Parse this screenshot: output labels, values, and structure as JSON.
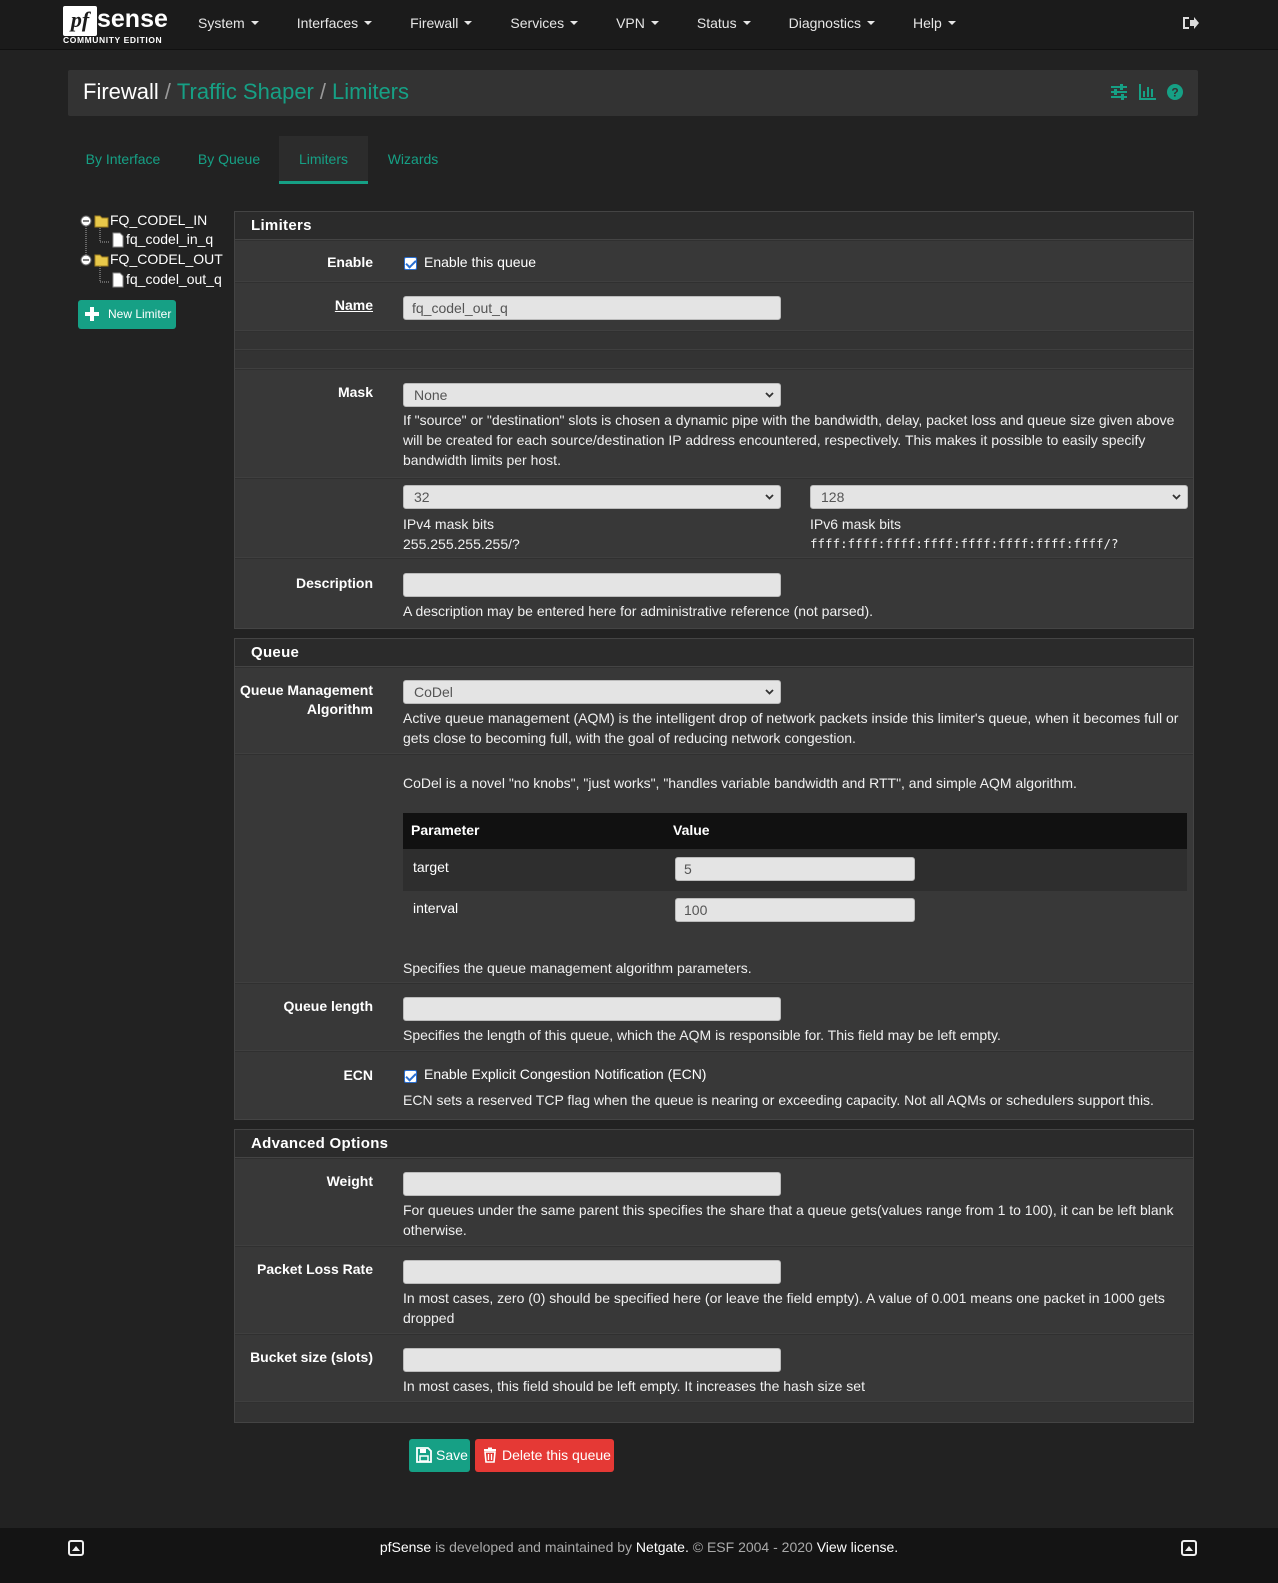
{
  "brand": {
    "logo_pf": "pf",
    "logo_sense": "sense",
    "edition": "COMMUNITY EDITION"
  },
  "nav": {
    "items": [
      "System",
      "Interfaces",
      "Firewall",
      "Services",
      "VPN",
      "Status",
      "Diagnostics",
      "Help"
    ]
  },
  "breadcrumb": {
    "root": "Firewall",
    "sep": "/",
    "level1": "Traffic Shaper",
    "level2": "Limiters"
  },
  "tabs": [
    "By Interface",
    "By Queue",
    "Limiters",
    "Wizards"
  ],
  "active_tab": "Limiters",
  "tree": {
    "limiter1": "FQ_CODEL_IN",
    "queue1": "fq_codel_in_q",
    "limiter2": "FQ_CODEL_OUT",
    "queue2": "fq_codel_out_q"
  },
  "new_limiter_label": "New Limiter",
  "limiters_panel": {
    "title": "Limiters",
    "enable_label": "Enable",
    "enable_checkbox_label": "Enable this queue",
    "name_label": "Name",
    "name_value": "fq_codel_out_q",
    "mask_label": "Mask",
    "mask_value": "None",
    "mask_help": "If \"source\" or \"destination\" slots is chosen a dynamic pipe with the bandwidth, delay, packet loss and queue size given above will be created for each source/destination IP address encountered, respectively. This makes it possible to easily specify bandwidth limits per host.",
    "ipv4_bits_value": "32",
    "ipv4_bits_label": "IPv4 mask bits",
    "ipv4_bits_hint": "255.255.255.255/?",
    "ipv6_bits_value": "128",
    "ipv6_bits_label": "IPv6 mask bits",
    "ipv6_bits_hint": "ffff:ffff:ffff:ffff:ffff:ffff:ffff:ffff/?",
    "description_label": "Description",
    "description_value": "",
    "description_help": "A description may be entered here for administrative reference (not parsed)."
  },
  "queue_panel": {
    "title": "Queue",
    "aqm_label_line1": "Queue Management",
    "aqm_label_line2": "Algorithm",
    "aqm_value": "CoDel",
    "aqm_help": "Active queue management (AQM) is the intelligent drop of network packets inside this limiter's queue, when it becomes full or gets close to becoming full, with the goal of reducing network congestion.",
    "codel_desc": "CoDel is a novel \"no knobs\", \"just works\", \"handles variable bandwidth and RTT\", and simple AQM algorithm.",
    "param_header": "Parameter",
    "value_header": "Value",
    "params": [
      {
        "name": "target",
        "value": "5"
      },
      {
        "name": "interval",
        "value": "100"
      }
    ],
    "params_help": "Specifies the queue management algorithm parameters.",
    "queue_length_label": "Queue length",
    "queue_length_value": "",
    "queue_length_help": "Specifies the length of this queue, which the AQM is responsible for. This field may be left empty.",
    "ecn_label": "ECN",
    "ecn_checkbox_label": "Enable Explicit Congestion Notification (ECN)",
    "ecn_help": "ECN sets a reserved TCP flag when the queue is nearing or exceeding capacity. Not all AQMs or schedulers support this."
  },
  "advanced_panel": {
    "title": "Advanced Options",
    "weight_label": "Weight",
    "weight_help": "For queues under the same parent this specifies the share that a queue gets(values range from 1 to 100), it can be left blank otherwise.",
    "plr_label": "Packet Loss Rate",
    "plr_help": "In most cases, zero (0) should be specified here (or leave the field empty). A value of 0.001 means one packet in 1000 gets dropped",
    "bucket_label": "Bucket size (slots)",
    "bucket_help": "In most cases, this field should be left empty. It increases the hash size set"
  },
  "buttons": {
    "save": "Save",
    "delete": "Delete this queue"
  },
  "footer": {
    "brand": "pfSense",
    "text1": " is developed and maintained by ",
    "company": "Netgate.",
    "text2": " © ESF 2004 - 2020 ",
    "license": "View license."
  },
  "colors": {
    "accent": "#16a085",
    "danger": "#e53935",
    "navbar": "#1b1b1b",
    "background": "#222222"
  }
}
